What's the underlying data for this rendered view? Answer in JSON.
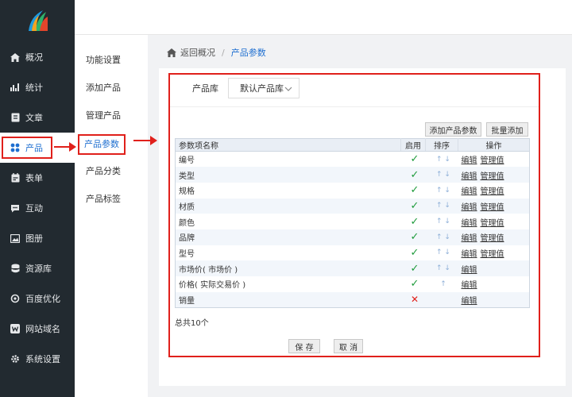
{
  "sidebar": {
    "items": [
      {
        "label": "概况",
        "icon": "home-icon"
      },
      {
        "label": "统计",
        "icon": "chart-icon"
      },
      {
        "label": "文章",
        "icon": "document-icon"
      },
      {
        "label": "产品",
        "icon": "grid-icon"
      },
      {
        "label": "表单",
        "icon": "calendar-icon"
      },
      {
        "label": "互动",
        "icon": "chat-icon"
      },
      {
        "label": "图册",
        "icon": "image-icon"
      },
      {
        "label": "资源库",
        "icon": "database-icon"
      },
      {
        "label": "百度优化",
        "icon": "refresh-icon"
      },
      {
        "label": "网站域名",
        "icon": "w-icon"
      },
      {
        "label": "系统设置",
        "icon": "gear-icon"
      }
    ]
  },
  "submenu": {
    "items": [
      "功能设置",
      "添加产品",
      "管理产品",
      "产品参数",
      "产品分类",
      "产品标签"
    ]
  },
  "breadcrumb": {
    "back": "返回概况",
    "separator": "/",
    "current": "产品参数"
  },
  "library": {
    "label": "产品库",
    "selected": "默认产品库"
  },
  "buttons": {
    "add_param": "添加产品参数",
    "batch_add": "批量添加",
    "save": "保 存",
    "cancel": "取 消"
  },
  "table": {
    "headers": {
      "name": "参数项名称",
      "enabled": "启用",
      "sort": "排序",
      "ops": "操作"
    },
    "edit_label": "编辑",
    "manage_label": "管理值",
    "rows": [
      {
        "name": "编号",
        "enabled": "✓",
        "sort": "↑ ↓",
        "manage": true
      },
      {
        "name": "类型",
        "enabled": "✓",
        "sort": "↑ ↓",
        "manage": true
      },
      {
        "name": "规格",
        "enabled": "✓",
        "sort": "↑ ↓",
        "manage": true
      },
      {
        "name": "材质",
        "enabled": "✓",
        "sort": "↑ ↓",
        "manage": true
      },
      {
        "name": "颜色",
        "enabled": "✓",
        "sort": "↑ ↓",
        "manage": true
      },
      {
        "name": "品牌",
        "enabled": "✓",
        "sort": "↑ ↓",
        "manage": true
      },
      {
        "name": "型号",
        "enabled": "✓",
        "sort": "↑ ↓",
        "manage": true
      },
      {
        "name": "市场价( 市场价 )",
        "enabled": "✓",
        "sort": "↑ ↓",
        "manage": false
      },
      {
        "name": "价格( 实际交易价 )",
        "enabled": "✓",
        "sort": "↑",
        "manage": false
      },
      {
        "name": "销量",
        "enabled": "✕",
        "sort": "",
        "manage": false
      }
    ]
  },
  "total_text": "总共10个",
  "colors": {
    "accent": "#1f6fd0",
    "highlight": "#e0201b",
    "check": "#1e9b3b",
    "sidebar_bg": "#222a30"
  }
}
